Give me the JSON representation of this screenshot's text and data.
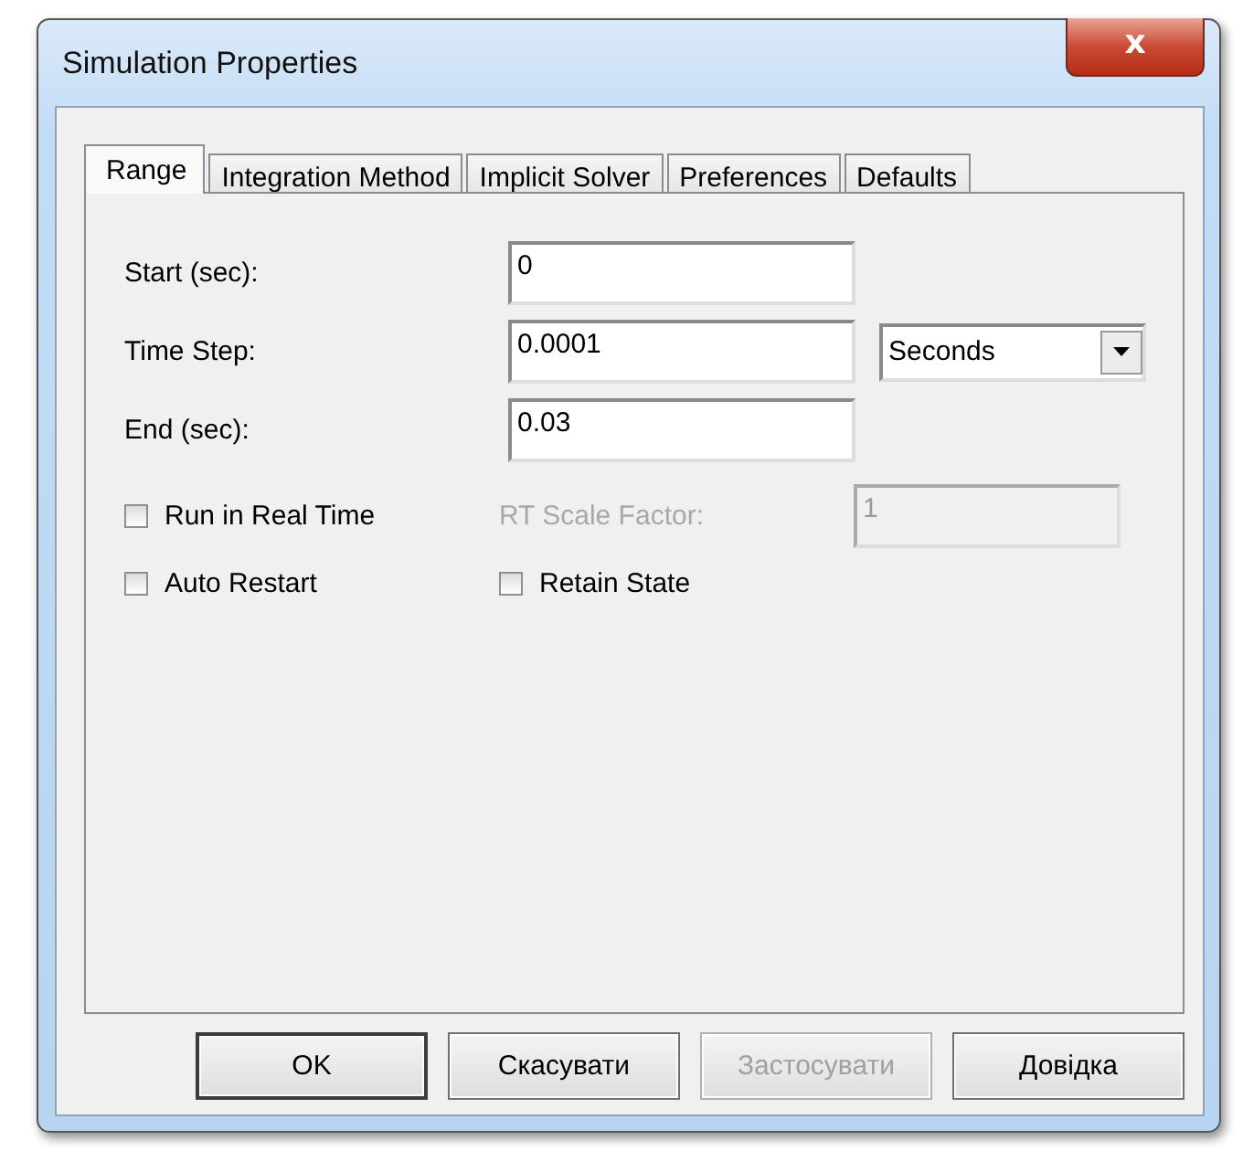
{
  "window": {
    "title": "Simulation Properties",
    "close_symbol": "x"
  },
  "tabs": [
    {
      "label": "Range",
      "selected": true
    },
    {
      "label": "Integration Method",
      "selected": false
    },
    {
      "label": "Implicit Solver",
      "selected": false
    },
    {
      "label": "Preferences",
      "selected": false
    },
    {
      "label": "Defaults",
      "selected": false
    }
  ],
  "fields": [
    {
      "label": "Start (sec):",
      "value": "0"
    },
    {
      "label": "Time Step:",
      "value": "0.0001",
      "unit": "Seconds"
    },
    {
      "label": "End (sec):",
      "value": "0.03"
    }
  ],
  "options": [
    {
      "label": "Run in Real Time",
      "checked": false,
      "extra_label": "RT Scale Factor:",
      "extra_value": "1",
      "extra_disabled": true
    },
    {
      "label": "Auto Restart",
      "checked": false
    },
    {
      "label": "Retain State",
      "checked": false
    }
  ],
  "buttons": [
    {
      "label": "OK",
      "disabled": false,
      "default": true
    },
    {
      "label": "Скасувати",
      "disabled": false,
      "default": false
    },
    {
      "label": "Застосувати",
      "disabled": true,
      "default": false
    },
    {
      "label": "Довідка",
      "disabled": false,
      "default": false
    }
  ]
}
